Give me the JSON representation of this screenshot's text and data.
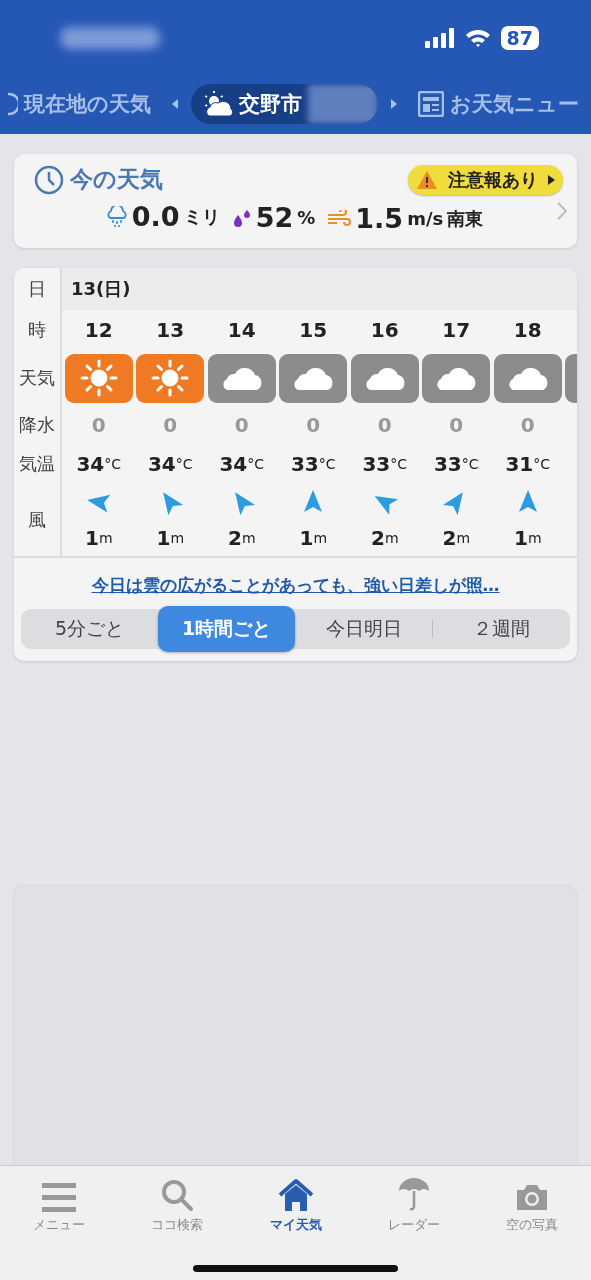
{
  "status_bar": {
    "battery": "87"
  },
  "location_tabs": [
    {
      "label": "現在地の天気",
      "kind": "location",
      "selected": false
    },
    {
      "label": "交野市",
      "kind": "city",
      "selected": true
    },
    {
      "label": "お天気ニュー",
      "kind": "news",
      "selected": false
    }
  ],
  "current": {
    "title": "今の天気",
    "alert": "注意報あり",
    "rain": {
      "value": "0.0",
      "unit": "ミリ"
    },
    "humidity": {
      "value": "52",
      "unit": "%"
    },
    "wind": {
      "value": "1.5",
      "unit": "m/s",
      "direction": "南東"
    }
  },
  "forecast": {
    "row_labels": {
      "day": "日",
      "hour": "時",
      "weather": "天気",
      "precip": "降水",
      "temp": "気温",
      "wind": "風"
    },
    "date": "13(日)",
    "hours": [
      {
        "hour": "12",
        "kind": "sunny",
        "precip": "0",
        "temp": "34",
        "temp_unit": "°C",
        "wind_arrow": {
          "kind": "w"
        },
        "wind": "1",
        "wind_unit": "m"
      },
      {
        "hour": "13",
        "kind": "sunny",
        "precip": "0",
        "temp": "34",
        "temp_unit": "°C",
        "wind_arrow": {
          "kind": "nw"
        },
        "wind": "1",
        "wind_unit": "m"
      },
      {
        "hour": "14",
        "kind": "cloudy",
        "precip": "0",
        "temp": "34",
        "temp_unit": "°C",
        "wind_arrow": {
          "kind": "nw"
        },
        "wind": "2",
        "wind_unit": "m"
      },
      {
        "hour": "15",
        "kind": "cloudy",
        "precip": "0",
        "temp": "33",
        "temp_unit": "°C",
        "wind_arrow": {
          "kind": "n"
        },
        "wind": "1",
        "wind_unit": "m"
      },
      {
        "hour": "16",
        "kind": "cloudy",
        "precip": "0",
        "temp": "33",
        "temp_unit": "°C",
        "wind_arrow": {
          "kind": "wnw"
        },
        "wind": "2",
        "wind_unit": "m"
      },
      {
        "hour": "17",
        "kind": "cloudy",
        "precip": "0",
        "temp": "33",
        "temp_unit": "°C",
        "wind_arrow": {
          "kind": "ne"
        },
        "wind": "2",
        "wind_unit": "m"
      },
      {
        "hour": "18",
        "kind": "cloudy",
        "precip": "0",
        "temp": "31",
        "temp_unit": "°C",
        "wind_arrow": {
          "kind": "n"
        },
        "wind": "1",
        "wind_unit": "m"
      }
    ],
    "summary_link": "今日は雲の広がることがあっても、強い日差しが照…",
    "modes": [
      {
        "label": "5分ごと",
        "selected": false
      },
      {
        "label": "1時間ごと",
        "selected": true
      },
      {
        "label": "今日明日",
        "selected": false
      },
      {
        "label": "２週間",
        "selected": false
      }
    ]
  },
  "nav": [
    {
      "label": "メニュー",
      "kind": "menu",
      "selected": false
    },
    {
      "label": "ココ検索",
      "kind": "search",
      "selected": false
    },
    {
      "label": "マイ天気",
      "kind": "home",
      "selected": true
    },
    {
      "label": "レーダー",
      "kind": "radar",
      "selected": false
    },
    {
      "label": "空の写真",
      "kind": "camera",
      "selected": false
    }
  ]
}
